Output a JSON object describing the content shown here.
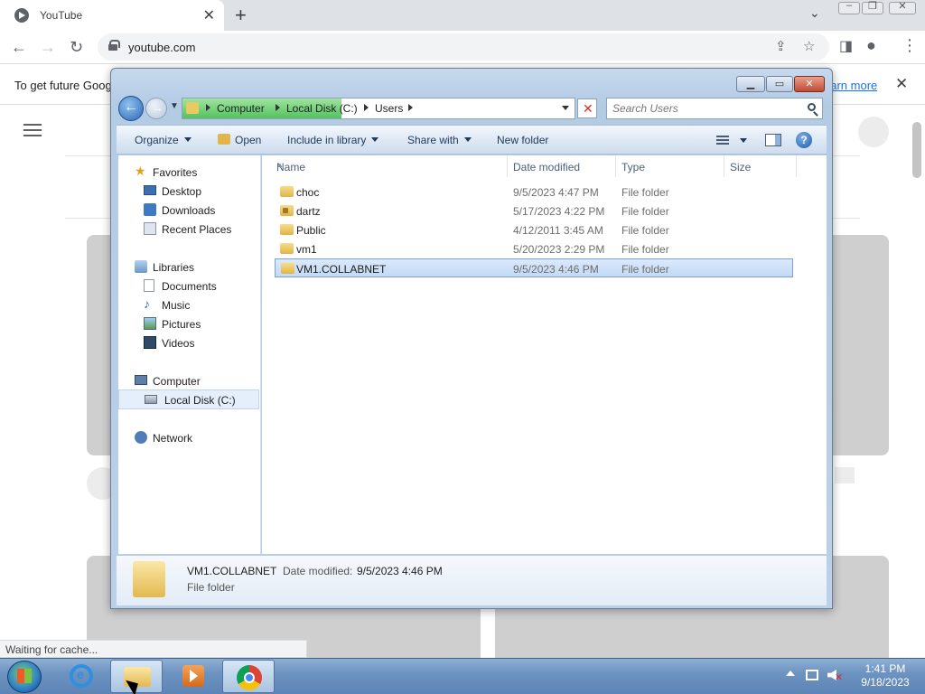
{
  "browser": {
    "tab_title": "YouTube",
    "tab_close_glyph": "✕",
    "new_tab_glyph": "+",
    "tab_menu_glyph": "⌄",
    "url": "youtube.com",
    "infobar_text": "To get future Goog",
    "infobar_link": "earn more",
    "infobar_close_glyph": "✕",
    "status_text": "Waiting for cache..."
  },
  "explorer": {
    "breadcrumb": [
      "Computer",
      "Local Disk (C:)",
      "Users"
    ],
    "search_placeholder": "Search Users",
    "toolbar": {
      "organize": "Organize",
      "open": "Open",
      "include_in_library": "Include in library",
      "share_with": "Share with",
      "new_folder": "New folder"
    },
    "nav": {
      "favorites": "Favorites",
      "desktop": "Desktop",
      "downloads": "Downloads",
      "recent_places": "Recent Places",
      "libraries": "Libraries",
      "documents": "Documents",
      "music": "Music",
      "pictures": "Pictures",
      "videos": "Videos",
      "computer": "Computer",
      "local_disk": "Local Disk (C:)",
      "network": "Network"
    },
    "columns": {
      "name": "Name",
      "date_modified": "Date modified",
      "type": "Type",
      "size": "Size"
    },
    "files": [
      {
        "name": "choc",
        "date": "9/5/2023 4:47 PM",
        "type": "File folder"
      },
      {
        "name": "dartz",
        "date": "5/17/2023 4:22 PM",
        "type": "File folder"
      },
      {
        "name": "Public",
        "date": "4/12/2011 3:45 AM",
        "type": "File folder"
      },
      {
        "name": "vm1",
        "date": "5/20/2023 2:29 PM",
        "type": "File folder"
      },
      {
        "name": "VM1.COLLABNET",
        "date": "9/5/2023 4:46 PM",
        "type": "File folder"
      }
    ],
    "selected_file": "VM1.COLLABNET",
    "details": {
      "name": "VM1.COLLABNET",
      "date_label": "Date modified:",
      "date_value": "9/5/2023 4:46 PM",
      "type": "File folder"
    }
  },
  "taskbar": {
    "time": "1:41 PM",
    "date": "9/18/2023"
  },
  "colors": {
    "selection": "#c3d9f6",
    "address_progress": "#52c25f",
    "taskbar": "#6d93c0"
  }
}
